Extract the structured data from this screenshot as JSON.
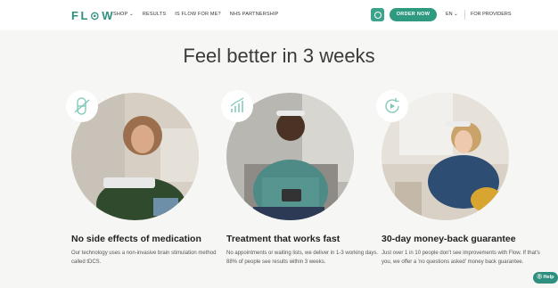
{
  "nav": {
    "logo": "FL⊙W",
    "shop": "SHOP ⌄",
    "results": "RESULTS",
    "is_flow": "IS FLOW FOR ME?",
    "nhs": "NHS PARTNERSHIP",
    "order_button": "ORDER NOW",
    "lang": "EN ⌄",
    "providers": "FOR PROVIDERS"
  },
  "hero": {
    "heading": "Feel better in 3 weeks"
  },
  "features": [
    {
      "title": "No side effects of medication",
      "desc": "Our technology uses a non-invasive brain stimulation method called tDCS.",
      "icon": "pill-crossed-icon"
    },
    {
      "title": "Treatment that works fast",
      "desc": "No appointments or waiting lists, we deliver in 1-3 working days. 88% of people see results within 3 weeks.",
      "icon": "rising-chart-icon"
    },
    {
      "title": "30-day money-back guarantee",
      "desc": "Just over 1 in 10 people don't see improvements with Flow. If that's you, we offer a 'no questions asked' money back guarantee.",
      "icon": "refresh-play-icon"
    }
  ],
  "help": {
    "label": "⓪ Help"
  },
  "colors": {
    "brand": "#2f9a7f",
    "nav_bg": "#ffffff",
    "page_bg": "#f6f6f4"
  }
}
